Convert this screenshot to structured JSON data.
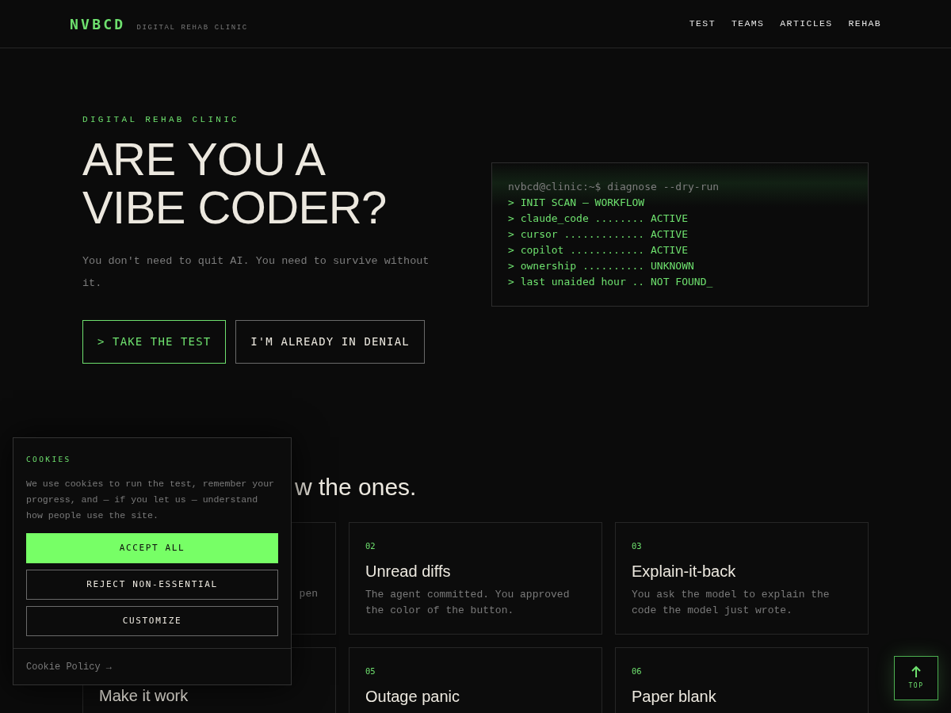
{
  "header": {
    "logo": "NVBCD",
    "tagline": "DIGITAL REHAB CLINIC",
    "nav": [
      "TEST",
      "TEAMS",
      "ARTICLES",
      "REHAB"
    ]
  },
  "hero": {
    "eyebrow": "DIGITAL REHAB CLINIC",
    "title_lines": [
      "ARE YOU A",
      "VIBE CODER?"
    ],
    "lead": "You don't need to quit AI. You need to survive without it.",
    "buttons": [
      {
        "label": "> TAKE THE TEST",
        "kind": "primary"
      },
      {
        "label": "I'M ALREADY IN DENIAL",
        "kind": "secondary"
      }
    ]
  },
  "terminal": {
    "lines": [
      {
        "text": "nvbcd@clinic:~$ diagnose --dry-run",
        "kind": "prompt"
      },
      {
        "text": "> INIT SCAN — WORKFLOW",
        "kind": "output"
      },
      {
        "text": "> claude_code ........ ACTIVE",
        "kind": "output"
      },
      {
        "text": "> cursor ............. ACTIVE",
        "kind": "output"
      },
      {
        "text": "> copilot ............ ACTIVE",
        "kind": "output"
      },
      {
        "text": "> ownership .......... UNKNOWN",
        "kind": "output"
      },
      {
        "text": "> last unaided hour .. NOT FOUND_",
        "kind": "output"
      }
    ]
  },
  "section": {
    "heading": "w the ones.",
    "cards": [
      {
        "description": "pen"
      },
      {
        "number": "02",
        "title": "Unread diffs",
        "description": "The agent committed. You approved the color of the button."
      },
      {
        "number": "03",
        "title": "Explain-it-back",
        "description": "You ask the model to explain the code the model just wrote."
      },
      {
        "title": "Make it work"
      },
      {
        "number": "05",
        "title": "Outage panic"
      },
      {
        "number": "06",
        "title": "Paper blank"
      }
    ]
  },
  "cookie_banner": {
    "title": "COOKIES",
    "text": "We use cookies to run the test, remember your progress, and — if you let us — understand how people use the site.",
    "buttons": [
      {
        "label": "ACCEPT ALL",
        "kind": "primary"
      },
      {
        "label": "REJECT NON-ESSENTIAL",
        "kind": "secondary"
      },
      {
        "label": "CUSTOMIZE",
        "kind": "secondary"
      }
    ],
    "policy_link": "Cookie Policy →"
  },
  "back_to_top": {
    "label": "TOP"
  }
}
